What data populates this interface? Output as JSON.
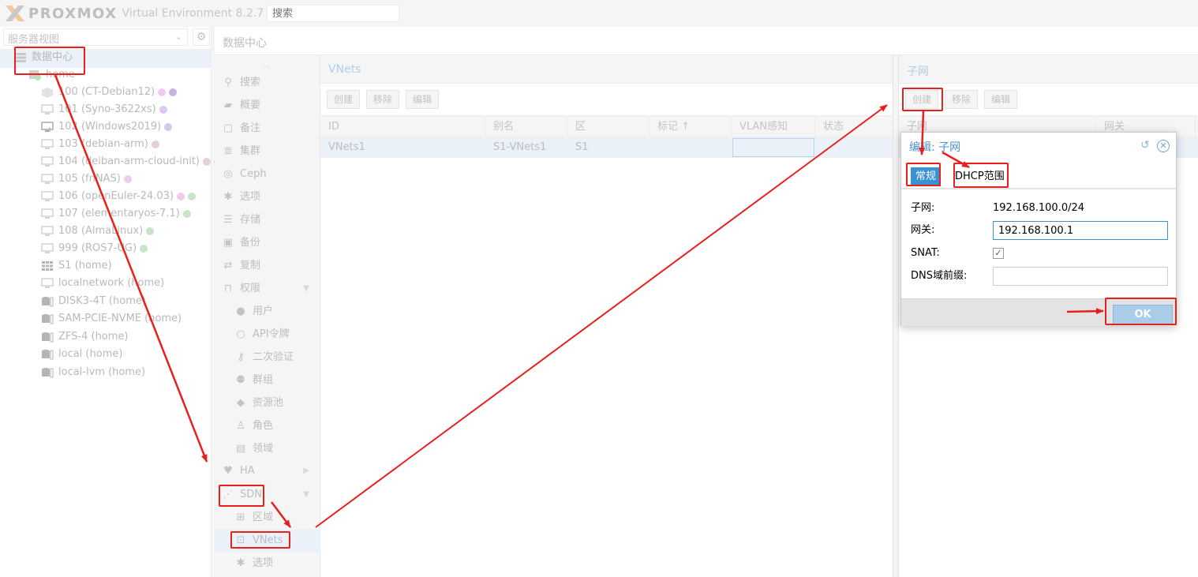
{
  "topbar": {
    "brand": "PROXMOX",
    "version_text": "Virtual Environment 8.2.7",
    "search_placeholder": "搜索"
  },
  "left": {
    "view_select": "服务器视图",
    "tree": [
      {
        "label": "数据中心",
        "type": "datacenter",
        "dots": []
      },
      {
        "label": "home",
        "type": "node",
        "dots": []
      },
      {
        "label": "100 (CT-Debian12)",
        "type": "container",
        "dots": [
          "#f0c8f0",
          "#c8b4e0"
        ]
      },
      {
        "label": "101 (Syno-3622xs)",
        "type": "vm",
        "dots": [
          "#dcc8f0"
        ]
      },
      {
        "label": "102 (Windows2019)",
        "type": "vm-running",
        "dots": [
          "#d4c8e4"
        ]
      },
      {
        "label": "103 (debian-arm)",
        "type": "vm",
        "dots": [
          "#e0d0d8"
        ]
      },
      {
        "label": "104 (deiban-arm-cloud-init)",
        "type": "vm",
        "dots": [
          "#e4d0dc",
          "#c8e8cc"
        ]
      },
      {
        "label": "105 (fnNAS)",
        "type": "vm",
        "dots": [
          "#f0cce8"
        ]
      },
      {
        "label": "106 (openEuler-24.03)",
        "type": "vm",
        "dots": [
          "#f0cce8",
          "#c8e4c8"
        ]
      },
      {
        "label": "107 (elementaryos-7.1)",
        "type": "vm",
        "dots": [
          "#c8e4c8"
        ]
      },
      {
        "label": "108 (AlmaLinux)",
        "type": "vm",
        "dots": [
          "#c8e4c8"
        ]
      },
      {
        "label": "999 (ROS7-UG)",
        "type": "vm",
        "dots": [
          "#c8e4c8"
        ]
      },
      {
        "label": "S1 (home)",
        "type": "zone",
        "dots": []
      },
      {
        "label": "localnetwork (home)",
        "type": "network",
        "dots": []
      },
      {
        "label": "DISK3-4T (home)",
        "type": "storage",
        "dots": []
      },
      {
        "label": "SAM-PCIE-NVME (home)",
        "type": "storage",
        "dots": []
      },
      {
        "label": "ZFS-4 (home)",
        "type": "storage",
        "dots": []
      },
      {
        "label": "local (home)",
        "type": "storage",
        "dots": []
      },
      {
        "label": "local-lvm (home)",
        "type": "storage",
        "dots": []
      }
    ]
  },
  "header": {
    "title": "数据中心"
  },
  "menu": [
    {
      "label": "搜索",
      "icon": "search-icon",
      "glyph": "⚲",
      "sub": false,
      "exp": ""
    },
    {
      "label": "概要",
      "icon": "book-icon",
      "glyph": "▰",
      "sub": false,
      "exp": ""
    },
    {
      "label": "备注",
      "icon": "note-icon",
      "glyph": "▢",
      "sub": false,
      "exp": ""
    },
    {
      "label": "集群",
      "icon": "server-icon",
      "glyph": "≣",
      "sub": false,
      "exp": ""
    },
    {
      "label": "Ceph",
      "icon": "ceph-icon",
      "glyph": "◎",
      "sub": false,
      "exp": ""
    },
    {
      "label": "选项",
      "icon": "gear-icon",
      "glyph": "✱",
      "sub": false,
      "exp": ""
    },
    {
      "label": "存储",
      "icon": "database-icon",
      "glyph": "☰",
      "sub": false,
      "exp": ""
    },
    {
      "label": "备份",
      "icon": "floppy-icon",
      "glyph": "▣",
      "sub": false,
      "exp": ""
    },
    {
      "label": "复制",
      "icon": "retweet-icon",
      "glyph": "⇄",
      "sub": false,
      "exp": ""
    },
    {
      "label": "权限",
      "icon": "unlock-icon",
      "glyph": "⊓",
      "sub": false,
      "exp": "▼"
    },
    {
      "label": "用户",
      "icon": "user-icon",
      "glyph": "●",
      "sub": true,
      "exp": ""
    },
    {
      "label": "API令牌",
      "icon": "user-o-icon",
      "glyph": "○",
      "sub": true,
      "exp": ""
    },
    {
      "label": "二次验证",
      "icon": "key-icon",
      "glyph": "⚷",
      "sub": true,
      "exp": ""
    },
    {
      "label": "群组",
      "icon": "users-icon",
      "glyph": "⚉",
      "sub": true,
      "exp": ""
    },
    {
      "label": "资源池",
      "icon": "tags-icon",
      "glyph": "◆",
      "sub": true,
      "exp": ""
    },
    {
      "label": "角色",
      "icon": "male-icon",
      "glyph": "♙",
      "sub": true,
      "exp": ""
    },
    {
      "label": "领域",
      "icon": "address-book-icon",
      "glyph": "▤",
      "sub": true,
      "exp": ""
    },
    {
      "label": "HA",
      "icon": "heartbeat-icon",
      "glyph": "♥",
      "sub": false,
      "exp": "▶"
    },
    {
      "label": "SDN",
      "icon": "sdn-icon",
      "glyph": "⋰",
      "sub": false,
      "exp": "▼"
    },
    {
      "label": "区域",
      "icon": "th-icon",
      "glyph": "⊞",
      "sub": true,
      "exp": ""
    },
    {
      "label": "VNets",
      "icon": "network-icon",
      "glyph": "⊡",
      "sub": true,
      "exp": "",
      "active": true
    },
    {
      "label": "选项",
      "icon": "gear-icon",
      "glyph": "✱",
      "sub": true,
      "exp": ""
    }
  ],
  "vnets": {
    "title": "VNets",
    "buttons": [
      "创建",
      "移除",
      "编辑"
    ],
    "columns": [
      "ID",
      "别名",
      "区",
      "标记 ↑",
      "VLAN感知",
      "状态"
    ],
    "rows": [
      {
        "id": "VNets1",
        "alias": "S1-VNets1",
        "zone": "S1",
        "tag": "",
        "vlan": "",
        "state": ""
      }
    ]
  },
  "subnets": {
    "title": "子网",
    "buttons": [
      "创建",
      "移除",
      "编辑"
    ],
    "columns": [
      "子网",
      "网关"
    ]
  },
  "dialog": {
    "title": "编辑: 子网",
    "tabs": [
      "常规",
      "DHCP范围"
    ],
    "fields": {
      "subnet_label": "子网:",
      "subnet_value": "192.168.100.0/24",
      "gateway_label": "网关:",
      "gateway_value": "192.168.100.1",
      "snat_label": "SNAT:",
      "dns_label": "DNS域前缀:",
      "dns_value": ""
    },
    "ok_label": "OK"
  },
  "colors": {
    "accent": "#3892d4",
    "annotation_red": "#e8201c"
  }
}
